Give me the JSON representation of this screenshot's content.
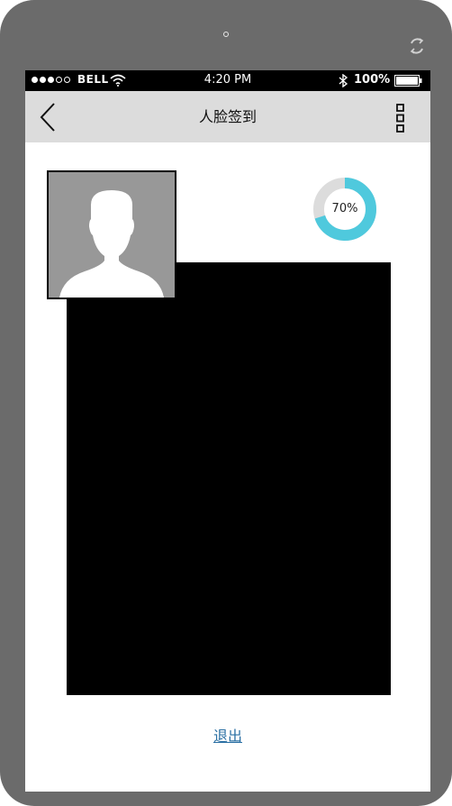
{
  "status_bar": {
    "carrier": "BELL",
    "time": "4:20 PM",
    "battery_percent": "100%",
    "signal_bars_filled": 3,
    "signal_bars_total": 5
  },
  "nav": {
    "title": "人脸签到"
  },
  "progress": {
    "value": 0.7,
    "label": "70%",
    "color": "#4fc9dd",
    "track_color": "#dcdcdc"
  },
  "actions": {
    "logout_label": "退出"
  },
  "icons": {
    "back": "back-chevron-icon",
    "menu": "more-vertical-icon",
    "rotate": "rotate-icon",
    "wifi": "wifi-icon",
    "bluetooth": "bluetooth-icon",
    "battery": "battery-icon",
    "avatar": "user-silhouette-icon"
  }
}
